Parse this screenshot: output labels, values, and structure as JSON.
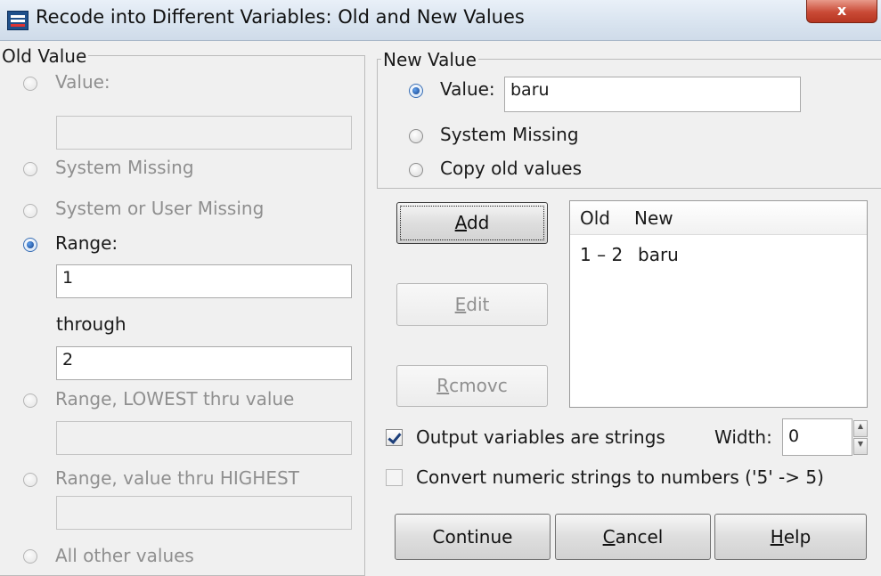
{
  "window": {
    "title": "Recode into Different Variables: Old and New Values",
    "close_glyph": "x"
  },
  "old_value": {
    "legend": "Old Value",
    "value_label": "Value:",
    "value_input": "",
    "system_missing_label": "System Missing",
    "system_or_user_missing_label": "System or User Missing",
    "range_label": "Range:",
    "range_from": "1",
    "through_label": "through",
    "range_to": "2",
    "range_lowest_label": "Range, LOWEST thru value",
    "range_lowest_input": "",
    "range_highest_label": "Range, value thru HIGHEST",
    "range_highest_input": "",
    "all_other_label": "All other values",
    "selected": "Range"
  },
  "new_value": {
    "legend": "New Value",
    "value_label": "Value:",
    "value_input": "baru",
    "system_missing_label": "System Missing",
    "copy_old_label": "Copy old values",
    "selected": "Value"
  },
  "actions": {
    "add": {
      "prefix": "",
      "mnemonic": "A",
      "rest": "dd"
    },
    "edit": {
      "prefix": "",
      "mnemonic": "E",
      "rest": "dit"
    },
    "remove": {
      "prefix": "",
      "mnemonic": "R",
      "rest": "cmovc"
    }
  },
  "mapping_list": {
    "headers": [
      "Old",
      "New"
    ],
    "rows": [
      {
        "old": "1 – 2",
        "new": "baru"
      }
    ]
  },
  "options": {
    "output_strings_label": "Output variables are strings",
    "output_strings_checked": true,
    "width_label": "Width:",
    "width_value": "0",
    "convert_label": "Convert numeric strings to numbers ('5' -> 5)",
    "convert_checked": false
  },
  "footer": {
    "continue": {
      "prefix": "Continue",
      "mnemonic": "",
      "rest": ""
    },
    "cancel": {
      "prefix": "",
      "mnemonic": "C",
      "rest": "ancel"
    },
    "help": {
      "prefix": "",
      "mnemonic": "H",
      "rest": "elp"
    }
  },
  "colors": {
    "dialog_bg": "#f0f0f0",
    "radio_selected": "#123f88",
    "close_button": "#c94a36"
  }
}
